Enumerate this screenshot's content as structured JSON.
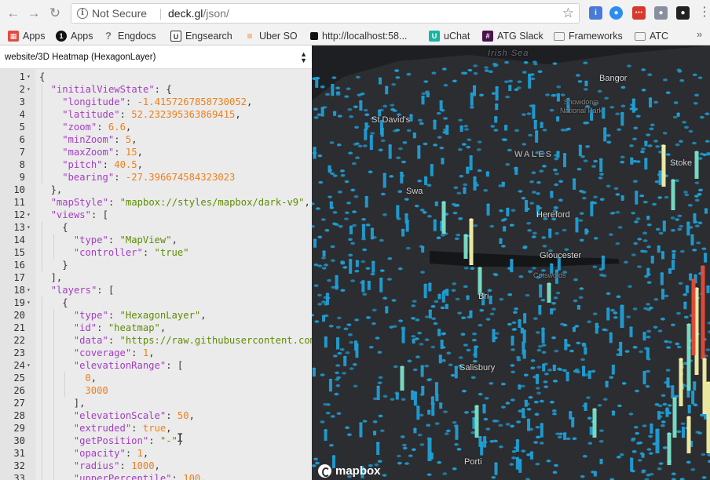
{
  "browser": {
    "url_security": "Not Secure",
    "url_host": "deck.gl",
    "url_path": "/json/",
    "bookmarks": [
      {
        "label": "Apps",
        "icon": "apps-grid-icon",
        "color": "#e34b3f"
      },
      {
        "label": "Apps",
        "icon": "uber-icon",
        "color": "#111111"
      },
      {
        "label": "Engdocs",
        "icon": "question-icon",
        "color": "#7c7c7c"
      },
      {
        "label": "Engsearch",
        "icon": "u-icon",
        "color": "#333333"
      },
      {
        "label": "Uber SO",
        "icon": "stack-overflow-icon",
        "color": "#f48024"
      },
      {
        "label": "http://localhost:58...",
        "icon": "black-square-icon",
        "color": "#111111"
      },
      {
        "label": "uChat",
        "icon": "uchat-icon",
        "color": "#19b5a3"
      },
      {
        "label": "ATG Slack",
        "icon": "slack-icon",
        "color": "#4a154b"
      },
      {
        "label": "Frameworks",
        "icon": "folder-icon",
        "color": "#8c8c8c"
      },
      {
        "label": "ATC",
        "icon": "folder-icon",
        "color": "#8c8c8c"
      }
    ]
  },
  "editor": {
    "selected_example": "website/3D Heatmap (HexagonLayer)",
    "lines": [
      {
        "n": "1",
        "fold": true,
        "indent": 0,
        "tokens": [
          [
            "p",
            "{"
          ]
        ]
      },
      {
        "n": "2",
        "fold": true,
        "indent": 1,
        "tokens": [
          [
            "k",
            "\"initialViewState\""
          ],
          [
            "p",
            ": {"
          ]
        ]
      },
      {
        "n": "3",
        "fold": false,
        "indent": 2,
        "tokens": [
          [
            "k",
            "\"longitude\""
          ],
          [
            "p",
            ": "
          ],
          [
            "n",
            "-1.4157267858730052"
          ],
          [
            "p",
            ","
          ]
        ]
      },
      {
        "n": "4",
        "fold": false,
        "indent": 2,
        "tokens": [
          [
            "k",
            "\"latitude\""
          ],
          [
            "p",
            ": "
          ],
          [
            "n",
            "52.232395363869415"
          ],
          [
            "p",
            ","
          ]
        ]
      },
      {
        "n": "5",
        "fold": false,
        "indent": 2,
        "tokens": [
          [
            "k",
            "\"zoom\""
          ],
          [
            "p",
            ": "
          ],
          [
            "n",
            "6.6"
          ],
          [
            "p",
            ","
          ]
        ]
      },
      {
        "n": "6",
        "fold": false,
        "indent": 2,
        "tokens": [
          [
            "k",
            "\"minZoom\""
          ],
          [
            "p",
            ": "
          ],
          [
            "n",
            "5"
          ],
          [
            "p",
            ","
          ]
        ]
      },
      {
        "n": "7",
        "fold": false,
        "indent": 2,
        "tokens": [
          [
            "k",
            "\"maxZoom\""
          ],
          [
            "p",
            ": "
          ],
          [
            "n",
            "15"
          ],
          [
            "p",
            ","
          ]
        ]
      },
      {
        "n": "8",
        "fold": false,
        "indent": 2,
        "tokens": [
          [
            "k",
            "\"pitch\""
          ],
          [
            "p",
            ": "
          ],
          [
            "n",
            "40.5"
          ],
          [
            "p",
            ","
          ]
        ]
      },
      {
        "n": "9",
        "fold": false,
        "indent": 2,
        "tokens": [
          [
            "k",
            "\"bearing\""
          ],
          [
            "p",
            ": "
          ],
          [
            "n",
            "-27.396674584323023"
          ]
        ]
      },
      {
        "n": "10",
        "fold": false,
        "indent": 1,
        "tokens": [
          [
            "p",
            "},"
          ]
        ]
      },
      {
        "n": "11",
        "fold": false,
        "indent": 1,
        "tokens": [
          [
            "k",
            "\"mapStyle\""
          ],
          [
            "p",
            ": "
          ],
          [
            "s",
            "\"mapbox://styles/mapbox/dark-v9\""
          ],
          [
            "p",
            ","
          ]
        ]
      },
      {
        "n": "12",
        "fold": true,
        "indent": 1,
        "tokens": [
          [
            "k",
            "\"views\""
          ],
          [
            "p",
            ": ["
          ]
        ]
      },
      {
        "n": "13",
        "fold": true,
        "indent": 2,
        "tokens": [
          [
            "p",
            "{"
          ]
        ]
      },
      {
        "n": "14",
        "fold": false,
        "indent": 3,
        "tokens": [
          [
            "k",
            "\"type\""
          ],
          [
            "p",
            ": "
          ],
          [
            "s",
            "\"MapView\""
          ],
          [
            "p",
            ","
          ]
        ]
      },
      {
        "n": "15",
        "fold": false,
        "indent": 3,
        "tokens": [
          [
            "k",
            "\"controller\""
          ],
          [
            "p",
            ": "
          ],
          [
            "s",
            "\"true\""
          ]
        ]
      },
      {
        "n": "16",
        "fold": false,
        "indent": 2,
        "tokens": [
          [
            "p",
            "}"
          ]
        ]
      },
      {
        "n": "17",
        "fold": false,
        "indent": 1,
        "tokens": [
          [
            "p",
            "],"
          ]
        ]
      },
      {
        "n": "18",
        "fold": true,
        "indent": 1,
        "tokens": [
          [
            "k",
            "\"layers\""
          ],
          [
            "p",
            ": ["
          ]
        ]
      },
      {
        "n": "19",
        "fold": true,
        "indent": 2,
        "tokens": [
          [
            "p",
            "{"
          ]
        ]
      },
      {
        "n": "20",
        "fold": false,
        "indent": 3,
        "tokens": [
          [
            "k",
            "\"type\""
          ],
          [
            "p",
            ": "
          ],
          [
            "s",
            "\"HexagonLayer\""
          ],
          [
            "p",
            ","
          ]
        ]
      },
      {
        "n": "21",
        "fold": false,
        "indent": 3,
        "tokens": [
          [
            "k",
            "\"id\""
          ],
          [
            "p",
            ": "
          ],
          [
            "s",
            "\"heatmap\""
          ],
          [
            "p",
            ","
          ]
        ]
      },
      {
        "n": "22",
        "fold": false,
        "indent": 3,
        "tokens": [
          [
            "k",
            "\"data\""
          ],
          [
            "p",
            ": "
          ],
          [
            "s",
            "\"https://raw.githubusercontent.com/"
          ]
        ]
      },
      {
        "n": "23",
        "fold": false,
        "indent": 3,
        "tokens": [
          [
            "k",
            "\"coverage\""
          ],
          [
            "p",
            ": "
          ],
          [
            "n",
            "1"
          ],
          [
            "p",
            ","
          ]
        ]
      },
      {
        "n": "24",
        "fold": true,
        "indent": 3,
        "tokens": [
          [
            "k",
            "\"elevationRange\""
          ],
          [
            "p",
            ": ["
          ]
        ]
      },
      {
        "n": "25",
        "fold": false,
        "indent": 4,
        "tokens": [
          [
            "n",
            "0"
          ],
          [
            "p",
            ","
          ]
        ]
      },
      {
        "n": "26",
        "fold": false,
        "indent": 4,
        "tokens": [
          [
            "n",
            "3000"
          ]
        ]
      },
      {
        "n": "27",
        "fold": false,
        "indent": 3,
        "tokens": [
          [
            "p",
            "],"
          ]
        ]
      },
      {
        "n": "28",
        "fold": false,
        "indent": 3,
        "tokens": [
          [
            "k",
            "\"elevationScale\""
          ],
          [
            "p",
            ": "
          ],
          [
            "n",
            "50"
          ],
          [
            "p",
            ","
          ]
        ]
      },
      {
        "n": "29",
        "fold": false,
        "indent": 3,
        "tokens": [
          [
            "k",
            "\"extruded\""
          ],
          [
            "p",
            ": "
          ],
          [
            "b",
            "true"
          ],
          [
            "p",
            ","
          ]
        ]
      },
      {
        "n": "30",
        "fold": false,
        "indent": 3,
        "tokens": [
          [
            "k",
            "\"getPosition\""
          ],
          [
            "p",
            ": "
          ],
          [
            "s",
            "\"-\""
          ],
          [
            "p",
            ","
          ]
        ]
      },
      {
        "n": "31",
        "fold": false,
        "indent": 3,
        "tokens": [
          [
            "k",
            "\"opacity\""
          ],
          [
            "p",
            ": "
          ],
          [
            "n",
            "1"
          ],
          [
            "p",
            ","
          ]
        ]
      },
      {
        "n": "32",
        "fold": false,
        "indent": 3,
        "tokens": [
          [
            "k",
            "\"radius\""
          ],
          [
            "p",
            ": "
          ],
          [
            "n",
            "1000"
          ],
          [
            "p",
            ","
          ]
        ]
      },
      {
        "n": "33",
        "fold": false,
        "indent": 3,
        "tokens": [
          [
            "k",
            "\"upperPercentile\""
          ],
          [
            "p",
            ": "
          ],
          [
            "n",
            "100"
          ],
          [
            "p",
            ","
          ]
        ]
      }
    ]
  },
  "map": {
    "sea_label": "Irish Sea",
    "region_label": "WALES",
    "park_label_line1": "Snowdonia",
    "park_label_line2": "National Park",
    "cotswolds": "Cotswolds",
    "places": {
      "bangor": "Bangor",
      "st_davids": "St David's",
      "stoke": "Stoke",
      "swansea": "Swa",
      "hereford": "Hereford",
      "gloucester": "Gloucester",
      "bristol": "Bri",
      "salisbury": "Salisbury",
      "portsmouth": "Porti"
    },
    "attribution": "mapbox",
    "colors": {
      "background": "#1e1f22",
      "land": "#2c2d30",
      "hex_low": "#1f9fd6",
      "hex_mid": "#7be2c9",
      "hex_high": "#f3f1a6",
      "hex_peak": "#e84a3a"
    }
  }
}
